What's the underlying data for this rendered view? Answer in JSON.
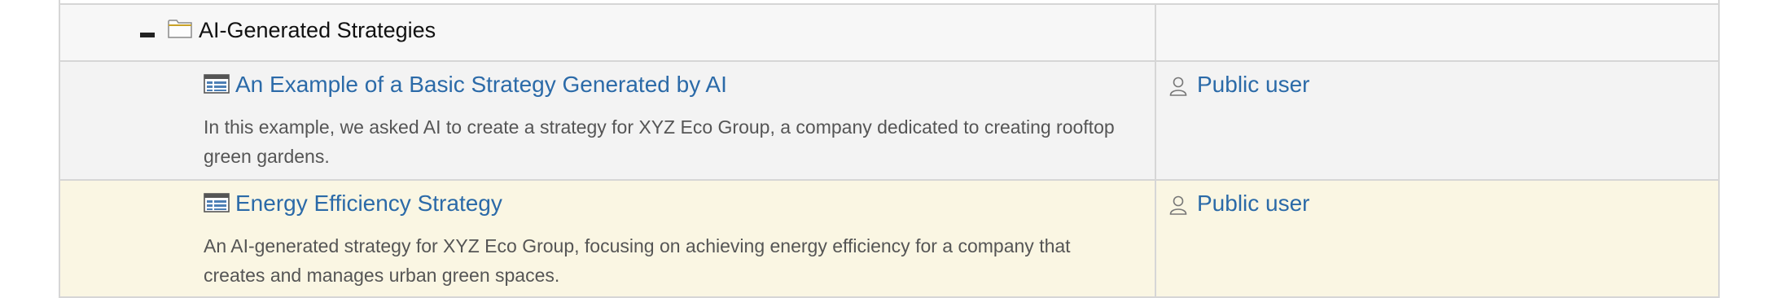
{
  "folder": {
    "title": "AI-Generated Strategies",
    "toggle_icon": "collapse-minus",
    "folder_icon": "folder-icon"
  },
  "items": [
    {
      "title": "An Example of a Basic Strategy Generated by AI",
      "description": "In this example, we asked AI to create a strategy for XYZ Eco Group, a company dedicated to creating rooftop green gardens.",
      "owner": "Public user",
      "icon": "strategy-map-icon"
    },
    {
      "title": "Energy Efficiency Strategy",
      "description": "An AI-generated strategy for XYZ Eco Group, focusing on achieving energy efficiency for a company that creates and manages urban green spaces.",
      "owner": "Public user",
      "icon": "strategy-map-icon"
    }
  ],
  "colors": {
    "link": "#2b6aa8",
    "highlight_row": "#faf6e3",
    "row_bg": "#f3f3f3",
    "border": "#d6d6d6"
  }
}
